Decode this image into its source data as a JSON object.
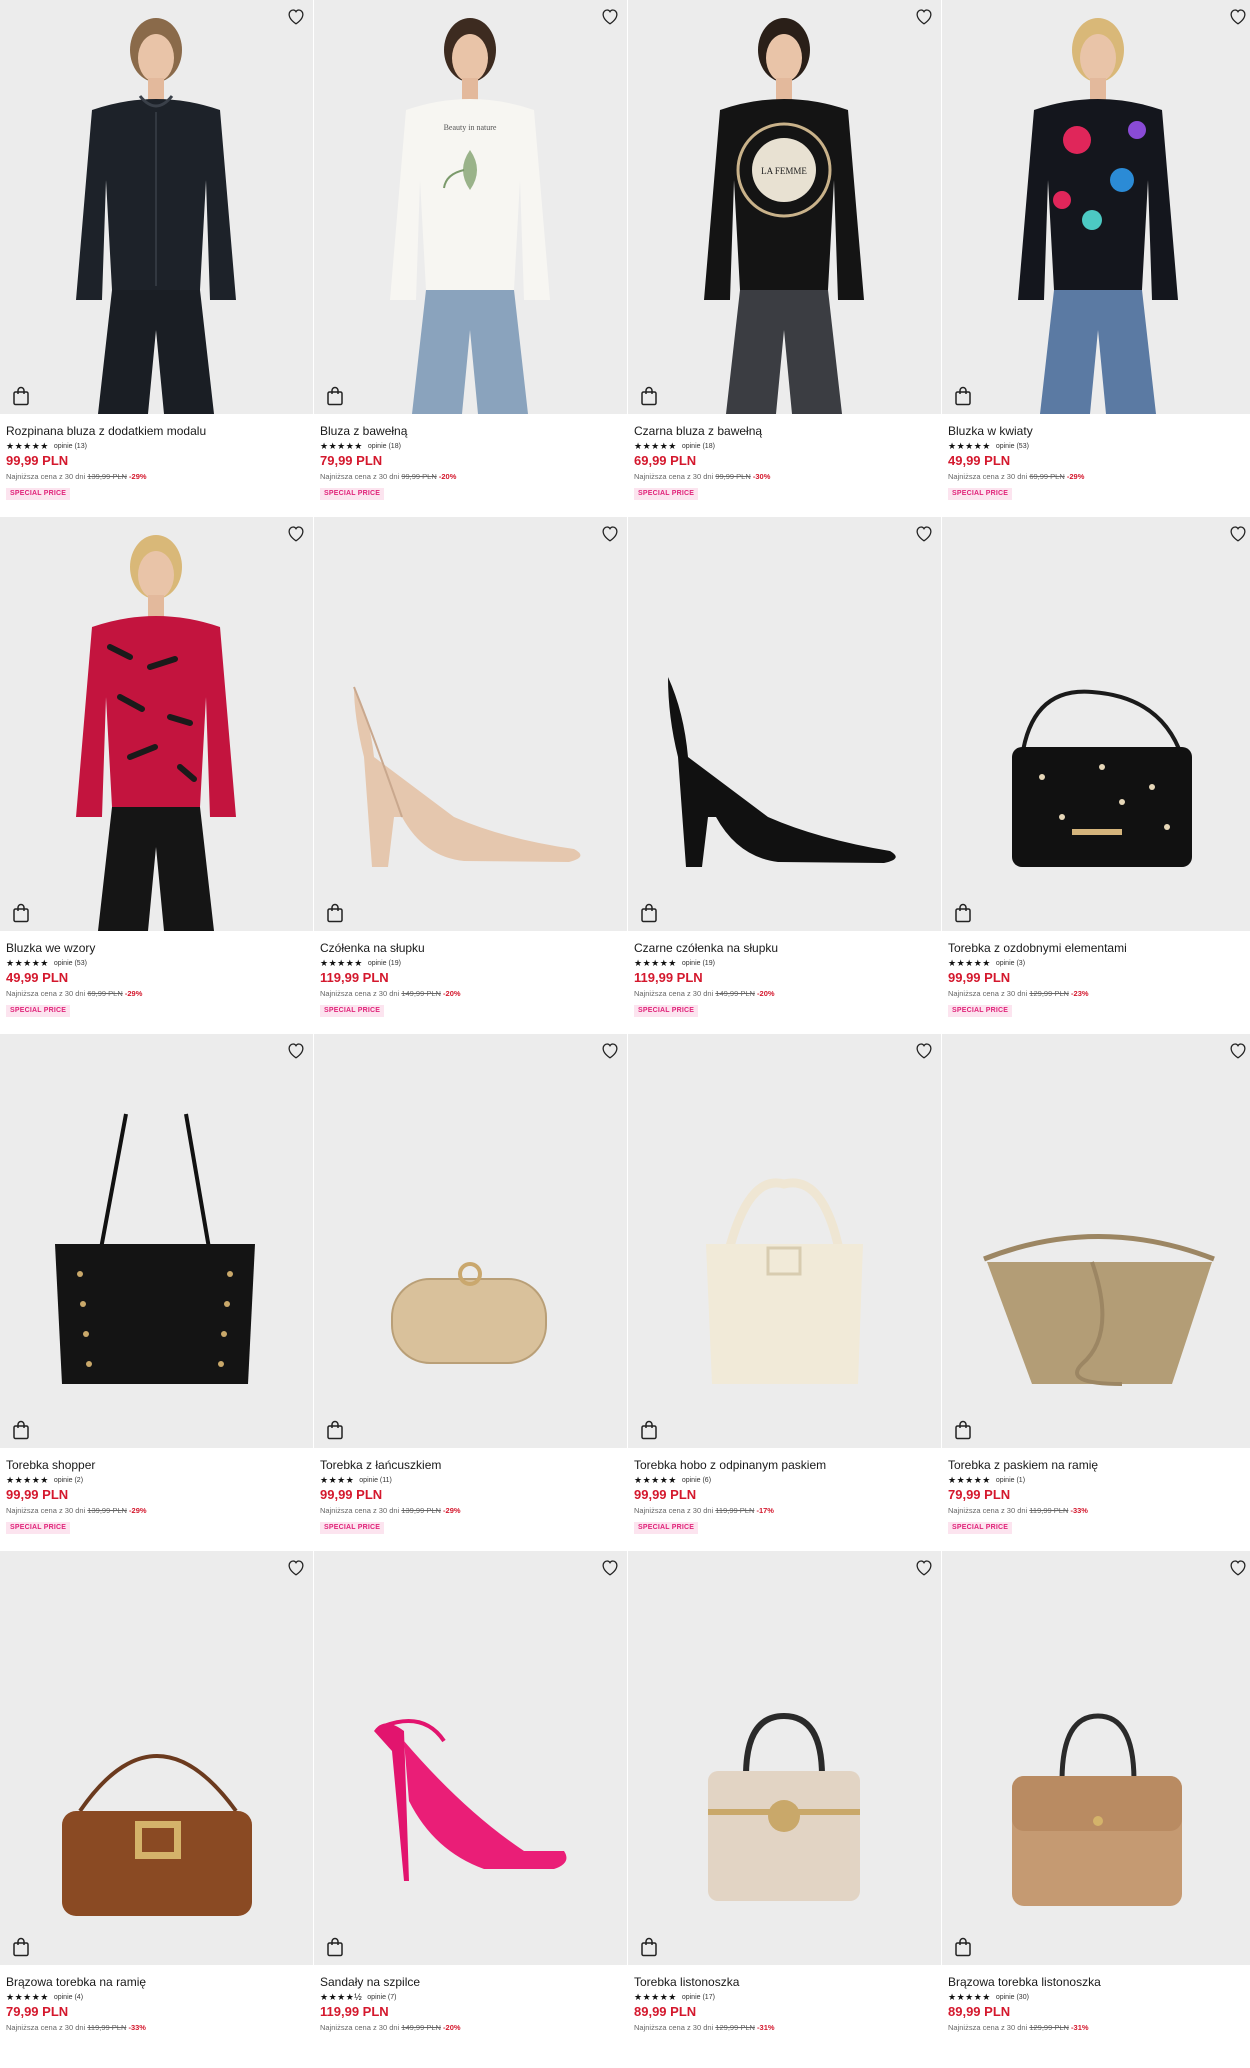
{
  "products": [
    {
      "name": "Rozpinana bluza z dodatkiem modalu",
      "stars": "★★★★★",
      "reviews": "opinie (13)",
      "price": "99,99 PLN",
      "lowest_label": "Najniższa cena z 30 dni",
      "old_price": "139,99 PLN",
      "discount": "-29%",
      "badge": "SPECIAL PRICE",
      "kind": "hoodie-black"
    },
    {
      "name": "Bluza z bawełną",
      "stars": "★★★★★",
      "reviews": "opinie (18)",
      "price": "79,99 PLN",
      "lowest_label": "Najniższa cena z 30 dni",
      "old_price": "99,99 PLN",
      "discount": "-20%",
      "badge": "SPECIAL PRICE",
      "kind": "sweat-white"
    },
    {
      "name": "Czarna bluza z bawełną",
      "stars": "★★★★★",
      "reviews": "opinie (18)",
      "price": "69,99 PLN",
      "lowest_label": "Najniższa cena z 30 dni",
      "old_price": "99,99 PLN",
      "discount": "-30%",
      "badge": "SPECIAL PRICE",
      "kind": "sweat-black"
    },
    {
      "name": "Bluzka w kwiaty",
      "stars": "★★★★★",
      "reviews": "opinie (53)",
      "price": "49,99 PLN",
      "lowest_label": "Najniższa cena z 30 dni",
      "old_price": "69,99 PLN",
      "discount": "-29%",
      "badge": "SPECIAL PRICE",
      "kind": "floral-top"
    },
    {
      "name": "Bluzka we wzory",
      "stars": "★★★★★",
      "reviews": "opinie (53)",
      "price": "49,99 PLN",
      "lowest_label": "Najniższa cena z 30 dni",
      "old_price": "69,99 PLN",
      "discount": "-29%",
      "badge": "SPECIAL PRICE",
      "kind": "pattern-top"
    },
    {
      "name": "Czółenka na słupku",
      "stars": "★★★★★",
      "reviews": "opinie (19)",
      "price": "119,99 PLN",
      "lowest_label": "Najniższa cena z 30 dni",
      "old_price": "149,99 PLN",
      "discount": "-20%",
      "badge": "SPECIAL PRICE",
      "kind": "pump-nude"
    },
    {
      "name": "Czarne czółenka na słupku",
      "stars": "★★★★★",
      "reviews": "opinie (19)",
      "price": "119,99 PLN",
      "lowest_label": "Najniższa cena z 30 dni",
      "old_price": "149,99 PLN",
      "discount": "-20%",
      "badge": "SPECIAL PRICE",
      "kind": "pump-black"
    },
    {
      "name": "Torebka z ozdobnymi elementami",
      "stars": "★★★★★",
      "reviews": "opinie (3)",
      "price": "99,99 PLN",
      "lowest_label": "Najniższa cena z 30 dni",
      "old_price": "129,99 PLN",
      "discount": "-23%",
      "badge": "SPECIAL PRICE",
      "kind": "bag-studded"
    },
    {
      "name": "Torebka shopper",
      "stars": "★★★★★",
      "reviews": "opinie (2)",
      "price": "99,99 PLN",
      "lowest_label": "Najniższa cena z 30 dni",
      "old_price": "139,99 PLN",
      "discount": "-29%",
      "badge": "SPECIAL PRICE",
      "kind": "bag-shopper"
    },
    {
      "name": "Torebka z łańcuszkiem",
      "stars": "★★★★",
      "reviews": "opinie (11)",
      "price": "99,99 PLN",
      "lowest_label": "Najniższa cena z 30 dni",
      "old_price": "139,99 PLN",
      "discount": "-29%",
      "badge": "SPECIAL PRICE",
      "kind": "bag-clutch"
    },
    {
      "name": "Torebka hobo z odpinanym paskiem",
      "stars": "★★★★★",
      "reviews": "opinie (6)",
      "price": "99,99 PLN",
      "lowest_label": "Najniższa cena z 30 dni",
      "old_price": "119,99 PLN",
      "discount": "-17%",
      "badge": "SPECIAL PRICE",
      "kind": "bag-hobo"
    },
    {
      "name": "Torebka z paskiem na ramię",
      "stars": "★★★★★",
      "reviews": "opinie (1)",
      "price": "79,99 PLN",
      "lowest_label": "Najniższa cena z 30 dni",
      "old_price": "119,99 PLN",
      "discount": "-33%",
      "badge": "SPECIAL PRICE",
      "kind": "bag-taupe"
    },
    {
      "name": "Brązowa torebka na ramię",
      "stars": "★★★★★",
      "reviews": "opinie (4)",
      "price": "79,99 PLN",
      "lowest_label": "Najniższa cena z 30 dni",
      "old_price": "119,99 PLN",
      "discount": "-33%",
      "badge": "",
      "kind": "bag-brown"
    },
    {
      "name": "Sandały na szpilce",
      "stars": "★★★★½",
      "reviews": "opinie (7)",
      "price": "119,99 PLN",
      "lowest_label": "Najniższa cena z 30 dni",
      "old_price": "149,99 PLN",
      "discount": "-20%",
      "badge": "",
      "kind": "sandal-pink"
    },
    {
      "name": "Torebka listonoszka",
      "stars": "★★★★★",
      "reviews": "opinie (17)",
      "price": "89,99 PLN",
      "lowest_label": "Najniższa cena z 30 dni",
      "old_price": "129,99 PLN",
      "discount": "-31%",
      "badge": "",
      "kind": "bag-beige"
    },
    {
      "name": "Brązowa torebka listonoszka",
      "stars": "★★★★★",
      "reviews": "opinie (30)",
      "price": "89,99 PLN",
      "lowest_label": "Najniższa cena z 30 dni",
      "old_price": "129,99 PLN",
      "discount": "-31%",
      "badge": "",
      "kind": "bag-monogram"
    }
  ],
  "icons": {
    "wishlist": "heart-icon",
    "add_to_bag": "shopping-bag-icon"
  },
  "colors": {
    "price": "#d4182d",
    "badge_text": "#e0247a",
    "badge_bg": "#fce4ef",
    "image_bg": "#ececec"
  }
}
